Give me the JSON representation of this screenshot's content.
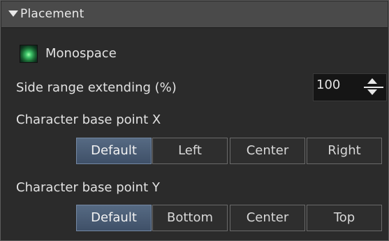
{
  "section": {
    "title": "Placement",
    "expanded": true
  },
  "monospace": {
    "label": "Monospace",
    "checked": true
  },
  "side_range": {
    "label": "Side range extending (%)",
    "value": "100"
  },
  "base_x": {
    "label": "Character base point X",
    "options": [
      "Default",
      "Left",
      "Center",
      "Right"
    ],
    "selected": "Default"
  },
  "base_y": {
    "label": "Character base point Y",
    "options": [
      "Default",
      "Bottom",
      "Center",
      "Top"
    ],
    "selected": "Default"
  },
  "colors": {
    "panel_bg": "#2b2b2b",
    "header_bg": "#4a4a4a",
    "selected_button": "#4d6079",
    "checkbox_on": "#3fc46a"
  }
}
